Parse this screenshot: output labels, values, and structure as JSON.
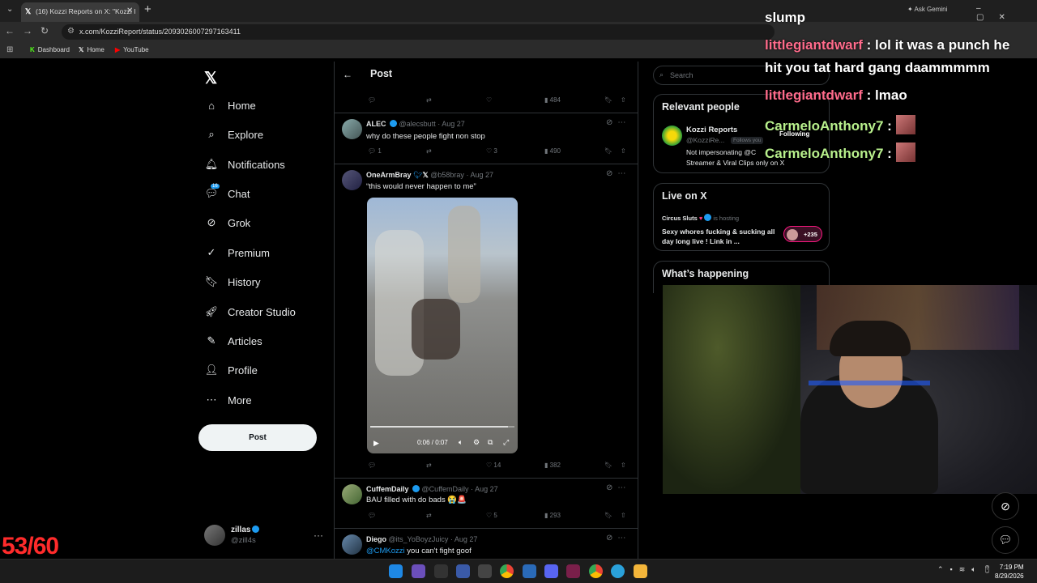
{
  "browser": {
    "tab_title": "(16) Kozzi Reports on X: \"Kozzi I",
    "url": "x.com/KozziReport/status/2093026007297163411",
    "bookmarks": [
      "Dashboard",
      "Home",
      "YouTube"
    ],
    "gemini": "Ask Gemini"
  },
  "nav": {
    "items": [
      "Home",
      "Explore",
      "Notifications",
      "Chat",
      "Grok",
      "Premium",
      "History",
      "Creator Studio",
      "Articles",
      "Profile",
      "More"
    ],
    "chat_badge": "16",
    "post_button": "Post",
    "user_name": "zillas",
    "user_handle": "@zill4s"
  },
  "counter": "53/60",
  "header": {
    "title": "Post"
  },
  "top_actions": {
    "views": "484"
  },
  "tweets": [
    {
      "name": "ALEC",
      "handle": "@alecsbutt",
      "date": "Aug 27",
      "text": "why do these people fight non stop",
      "replies": "1",
      "likes": "3",
      "views": "490"
    },
    {
      "name": "OneArmBray",
      "handle": "@b58bray",
      "date": "Aug 27",
      "text": "“this would never happen to me”",
      "video_time": "0:06 / 0:07",
      "likes": "14",
      "views": "382"
    },
    {
      "name": "CuffemDaily",
      "handle": "@CuffemDaily",
      "date": "Aug 27",
      "text": "BAU filled with do bads 😭🚨",
      "likes": "5",
      "views": "293"
    },
    {
      "name": "Diego",
      "handle": "@its_YoBoyzJuicy",
      "date": "Aug 27",
      "mention": "@CMKozzi",
      "text": "you can't fight goof"
    }
  ],
  "right": {
    "search_placeholder": "Search",
    "relevant_title": "Relevant people",
    "relevant_name": "Kozzi Reports",
    "relevant_handle": "@KozziRe...",
    "follows_you": "Follows you",
    "following": "Following",
    "relevant_bio_1": "Not impersonating @C",
    "relevant_bio_2": "Streamer & Viral Clips only on X",
    "live_title": "Live on X",
    "live_host": "Circus Sluts",
    "live_hosting": "is hosting",
    "live_text": "Sexy whores fucking & sucking all day long live ! Link in ...",
    "live_count": "+235",
    "happening_title": "What’s happening"
  },
  "chat": [
    {
      "user": "",
      "msg": "slump"
    },
    {
      "user": "littlegiantdwarf",
      "msg": ": lol it was a punch he"
    },
    {
      "user": "",
      "msg": "hit you tat hard gang daammmmm"
    },
    {
      "user": "littlegiantdwarf",
      "msg": ": lmao"
    },
    {
      "user": "CarmeloAnthony7",
      "msg": ":"
    },
    {
      "user": "CarmeloAnthony7",
      "msg": ":"
    }
  ],
  "clock": {
    "time": "7:19 PM",
    "date": "8/29/2026"
  },
  "colors": {
    "accent": "#1d9bf0",
    "counter": "#ff2b2b",
    "chat_pink": "#ff6b8b",
    "chat_green": "#b8f08c"
  }
}
